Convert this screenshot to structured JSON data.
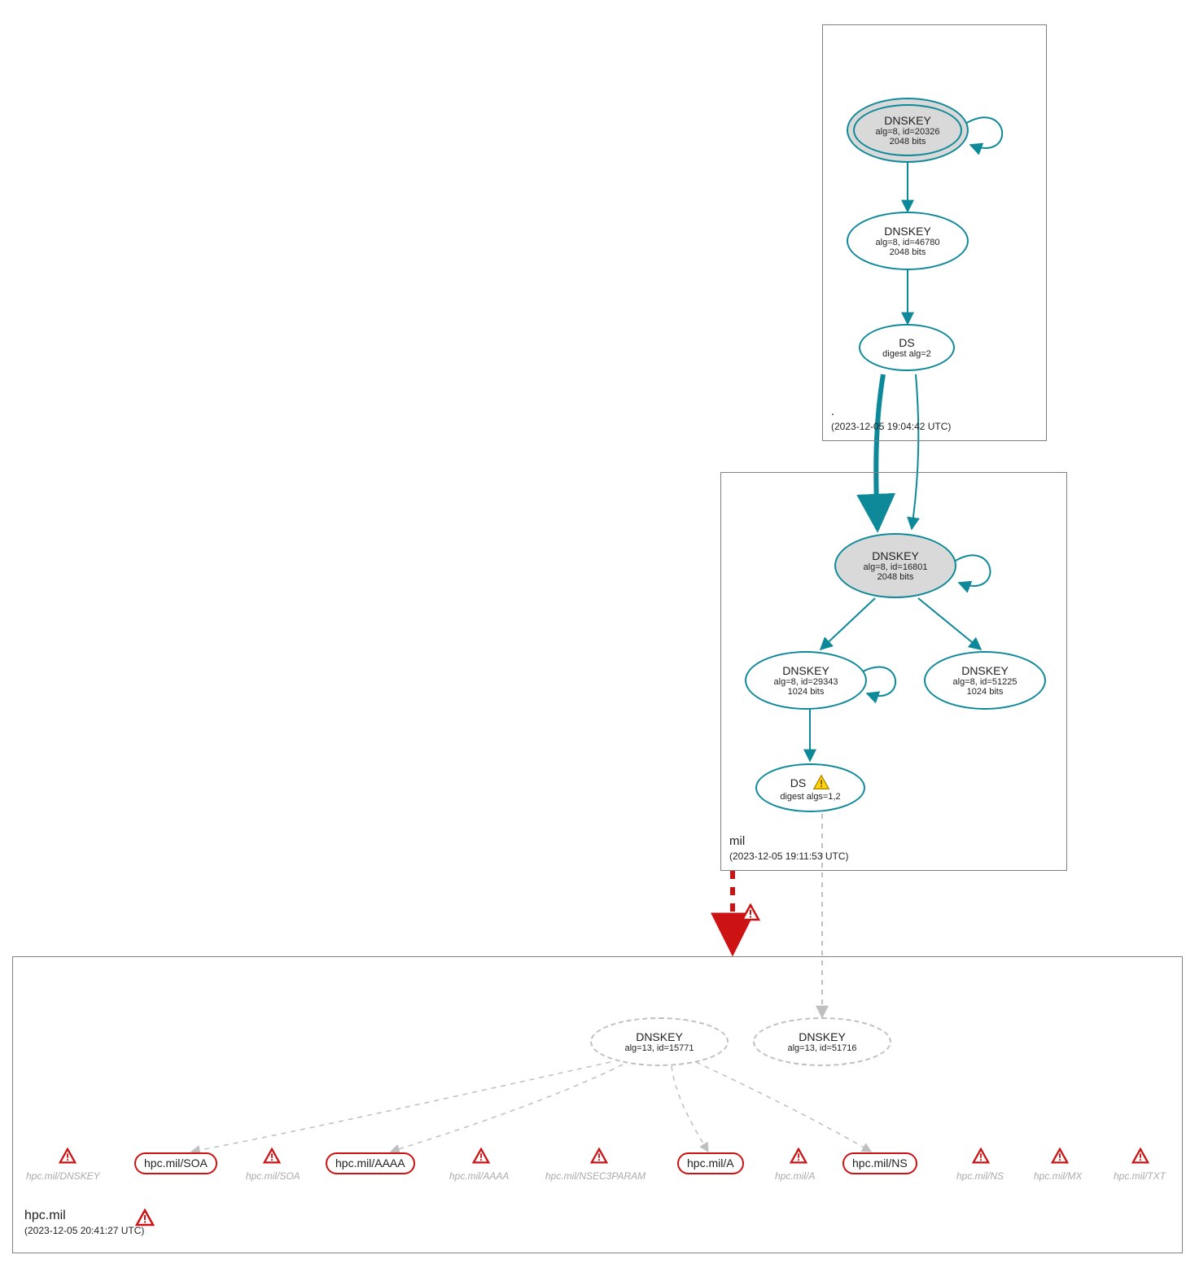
{
  "colors": {
    "teal": "#0e8999",
    "red": "#cc1212",
    "gray_box": "#808080",
    "gray_dash": "#bfbfbf",
    "fill_gray": "#d9d9d9",
    "warn_yellow": "#ffd60a",
    "warn_border": "#b38600"
  },
  "zones": {
    "root": {
      "name": ".",
      "timestamp": "(2023-12-05 19:04:42 UTC)",
      "nodes": {
        "ksk": {
          "title": "DNSKEY",
          "line2": "alg=8, id=20326",
          "line3": "2048 bits"
        },
        "zsk": {
          "title": "DNSKEY",
          "line2": "alg=8, id=46780",
          "line3": "2048 bits"
        },
        "ds": {
          "title": "DS",
          "line2": "digest alg=2"
        }
      }
    },
    "mil": {
      "name": "mil",
      "timestamp": "(2023-12-05 19:11:53 UTC)",
      "nodes": {
        "ksk": {
          "title": "DNSKEY",
          "line2": "alg=8, id=16801",
          "line3": "2048 bits"
        },
        "zsk1": {
          "title": "DNSKEY",
          "line2": "alg=8, id=29343",
          "line3": "1024 bits"
        },
        "zsk2": {
          "title": "DNSKEY",
          "line2": "alg=8, id=51225",
          "line3": "1024 bits"
        },
        "ds": {
          "title": "DS",
          "line2": "digest algs=1,2"
        }
      }
    },
    "hpc": {
      "name": "hpc.mil",
      "timestamp": "(2023-12-05 20:41:27 UTC)",
      "nodes": {
        "key1": {
          "title": "DNSKEY",
          "line2": "alg=13, id=15771"
        },
        "key2": {
          "title": "DNSKEY",
          "line2": "alg=13, id=51716"
        }
      },
      "rrsets": {
        "soa": "hpc.mil/SOA",
        "aaaa": "hpc.mil/AAAA",
        "a": "hpc.mil/A",
        "ns": "hpc.mil/NS"
      },
      "gray_rr": {
        "dnskey": "hpc.mil/DNSKEY",
        "soa": "hpc.mil/SOA",
        "aaaa": "hpc.mil/AAAA",
        "nsec3param": "hpc.mil/NSEC3PARAM",
        "a": "hpc.mil/A",
        "ns": "hpc.mil/NS",
        "mx": "hpc.mil/MX",
        "txt": "hpc.mil/TXT"
      }
    }
  }
}
